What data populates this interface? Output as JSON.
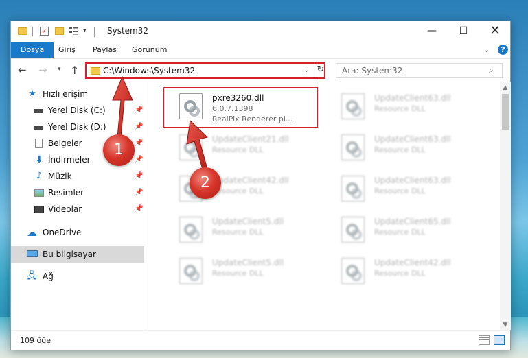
{
  "window": {
    "title": "System32",
    "min": "—",
    "max": "☐",
    "close": "✕"
  },
  "ribbon": {
    "tabs": [
      "Dosya",
      "Giriş",
      "Paylaş",
      "Görünüm"
    ]
  },
  "address": {
    "path": "C:\\Windows\\System32",
    "search_placeholder": "Ara: System32"
  },
  "sidebar": {
    "items": [
      {
        "label": "Hızlı erişim",
        "icon": "star-icon"
      },
      {
        "label": "Yerel Disk (C:)",
        "icon": "disk-icon",
        "pinned": true
      },
      {
        "label": "Yerel Disk (D:)",
        "icon": "disk-icon",
        "pinned": true
      },
      {
        "label": "Belgeler",
        "icon": "documents-icon",
        "pinned": true
      },
      {
        "label": "İndirmeler",
        "icon": "download-icon",
        "pinned": true
      },
      {
        "label": "Müzik",
        "icon": "music-icon",
        "pinned": true
      },
      {
        "label": "Resimler",
        "icon": "pictures-icon",
        "pinned": true
      },
      {
        "label": "Videolar",
        "icon": "videos-icon",
        "pinned": true
      },
      {
        "label": "OneDrive",
        "icon": "cloud-icon"
      },
      {
        "label": "Bu bilgisayar",
        "icon": "computer-icon",
        "selected": true
      },
      {
        "label": "Ağ",
        "icon": "network-icon"
      }
    ]
  },
  "files": [
    {
      "name": "pxre3260.dll",
      "version": "6.0.7.1398",
      "description": "RealPix Renderer pl..."
    },
    {
      "name": "UpdateClient63.dll",
      "version": "Resource DLL"
    },
    {
      "name": "UpdateClient21.dll",
      "version": "Resource DLL"
    },
    {
      "name": "UpdateClient63.dll",
      "version": "Resource DLL"
    },
    {
      "name": "UpdateClient42.dll",
      "version": "Resource DLL"
    },
    {
      "name": "UpdateClient63.dll",
      "version": "Resource DLL"
    },
    {
      "name": "UpdateClient5.dll",
      "version": "Resource DLL"
    },
    {
      "name": "UpdateClient65.dll",
      "version": "Resource DLL"
    },
    {
      "name": "UpdateClient5.dll",
      "version": "Resource DLL"
    },
    {
      "name": "UpdateClient42.dll",
      "version": "Resource DLL"
    }
  ],
  "status": {
    "count": "109 öğe"
  },
  "callouts": [
    "1",
    "2"
  ],
  "colors": {
    "accent": "#1979ca",
    "highlight": "#d7202a"
  }
}
